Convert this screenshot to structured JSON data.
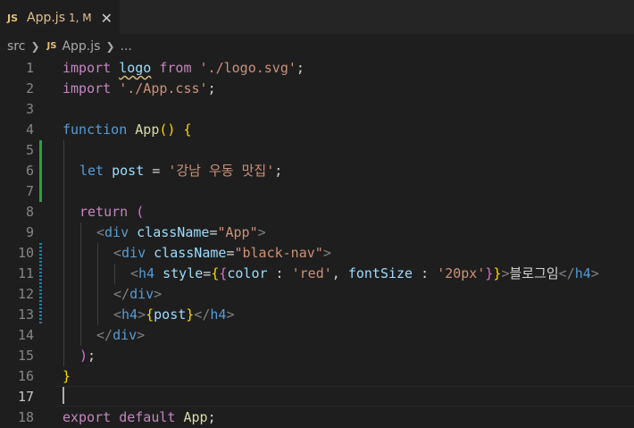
{
  "tab": {
    "icon_label": "JS",
    "title": "App.js",
    "status": "1, M",
    "close_glyph": "✕"
  },
  "breadcrumb": {
    "folder": "src",
    "icon_label": "JS",
    "file": "App.js",
    "more": "..."
  },
  "line_numbers": [
    "1",
    "2",
    "3",
    "4",
    "5",
    "6",
    "7",
    "8",
    "9",
    "10",
    "11",
    "12",
    "13",
    "14",
    "15",
    "16",
    "17",
    "18"
  ],
  "code": {
    "l1": {
      "import": "import",
      "logo": "logo",
      "from": "from",
      "path": "'./logo.svg'",
      "semi": ";"
    },
    "l2": {
      "import": "import",
      "path": "'./App.css'",
      "semi": ";"
    },
    "l4": {
      "function": "function",
      "name": "App",
      "parens": "()",
      "brace": "{"
    },
    "l6": {
      "let": "let",
      "var": "post",
      "eq": "=",
      "str": "'강남 우동 맛집'",
      "semi": ";"
    },
    "l8": {
      "return": "return",
      "paren": "("
    },
    "l9": {
      "open": "<",
      "tag": "div",
      "attr": "className",
      "eq": "=",
      "val": "\"App\"",
      "close": ">"
    },
    "l10": {
      "open": "<",
      "tag": "div",
      "attr": "className",
      "eq": "=",
      "val": "\"black-nav\"",
      "close": ">"
    },
    "l11": {
      "open": "<",
      "tag": "h4",
      "attr": "style",
      "eq": "=",
      "b1": "{",
      "b2": "{",
      "k1": "color",
      "c1": " : ",
      "v1": "'red'",
      "comma": ", ",
      "k2": "fontSize",
      "c2": " : ",
      "v2": "'20px'",
      "b3": "}",
      "b4": "}",
      "gt": ">",
      "text": "블로그임",
      "endopen": "</",
      "endtag": "h4",
      "endclose": ">"
    },
    "l12": {
      "open": "</",
      "tag": "div",
      "close": ">"
    },
    "l13": {
      "open": "<",
      "tag": "h4",
      "gt": ">",
      "b1": "{",
      "var": "post",
      "b2": "}",
      "endopen": "</",
      "endtag": "h4",
      "endclose": ">"
    },
    "l14": {
      "open": "</",
      "tag": "div",
      "close": ">"
    },
    "l15": {
      "paren": ")",
      "semi": ";"
    },
    "l16": {
      "brace": "}"
    },
    "l18": {
      "export": "export",
      "default": "default",
      "name": "App",
      "semi": ";"
    }
  }
}
